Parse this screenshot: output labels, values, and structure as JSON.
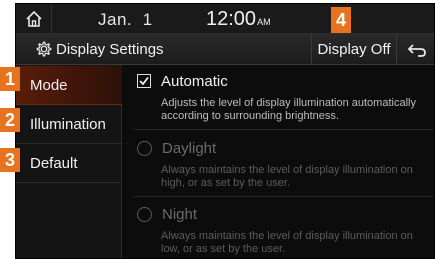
{
  "status": {
    "date": "Jan.  1",
    "time": "12:00",
    "ampm": "AM"
  },
  "header": {
    "title": "Display Settings",
    "display_off_label": "Display Off"
  },
  "callouts": [
    "1",
    "2",
    "3",
    "4"
  ],
  "sidebar": {
    "items": [
      {
        "label": "Mode",
        "active": true
      },
      {
        "label": "Illumination",
        "active": false
      },
      {
        "label": "Default",
        "active": false
      }
    ]
  },
  "options": [
    {
      "label": "Automatic",
      "selected": true,
      "description": "Adjusts the level of display illumination automatically according to surrounding brightness."
    },
    {
      "label": "Daylight",
      "selected": false,
      "description": "Always maintains the level of display illumination on high, or as set by the user."
    },
    {
      "label": "Night",
      "selected": false,
      "description": "Always maintains the level of display illumination on low, or as set by the user."
    }
  ],
  "icons": {
    "home": "home-icon",
    "settings": "gear-icon",
    "back": "back-arrow-icon",
    "check": "checkmark-icon"
  },
  "colors": {
    "accent": "#e8731e",
    "active_row": "#5a1d0a",
    "background": "#0a0a0a"
  }
}
